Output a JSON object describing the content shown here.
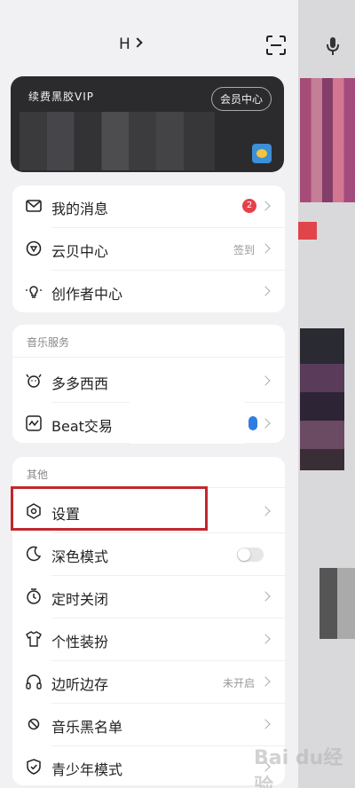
{
  "header": {
    "user_name": "H",
    "scan_icon": "scan-icon"
  },
  "vip": {
    "title": "续费黑胶VIP",
    "center_button": "会员中心"
  },
  "card1": {
    "rows": [
      {
        "label": "我的消息",
        "badge": "2",
        "icon": "mail-icon"
      },
      {
        "label": "云贝中心",
        "right": "签到",
        "icon": "coin-icon"
      },
      {
        "label": "创作者中心",
        "icon": "bulb-icon"
      }
    ]
  },
  "card2": {
    "title": "音乐服务",
    "rows": [
      {
        "label": "多多西西",
        "icon": "cow-icon"
      },
      {
        "label": "Beat交易",
        "icon": "beat-icon"
      }
    ]
  },
  "card3": {
    "title": "其他",
    "rows": [
      {
        "label": "设置",
        "icon": "settings-icon"
      },
      {
        "label": "深色模式",
        "icon": "moon-icon",
        "toggle": false
      },
      {
        "label": "定时关闭",
        "icon": "timer-icon"
      },
      {
        "label": "个性装扮",
        "icon": "shirt-icon"
      },
      {
        "label": "边听边存",
        "right": "未开启",
        "icon": "headphones-icon"
      },
      {
        "label": "音乐黑名单",
        "icon": "block-icon"
      },
      {
        "label": "青少年模式",
        "icon": "shield-icon"
      }
    ]
  },
  "colors": {
    "highlight": "#c1272d",
    "badge": "#e5414a"
  },
  "watermark": "Bai du经验"
}
